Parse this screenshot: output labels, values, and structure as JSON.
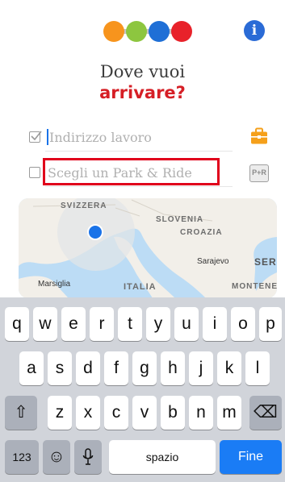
{
  "header": {
    "logo_colors": [
      "#f7941d",
      "#8dc63f",
      "#1f6fd6",
      "#e8222a"
    ],
    "info_icon": "info-icon",
    "info_symbol": "i"
  },
  "headline": {
    "line1": "Dove vuoi",
    "line2": "arrivare?",
    "accent_color": "#d61f26"
  },
  "fields": {
    "work": {
      "placeholder": "Indirizzo lavoro",
      "checked": true,
      "action_icon": "briefcase-icon",
      "action_color": "#f5a01b"
    },
    "park_ride": {
      "placeholder": "Scegli un Park & Ride",
      "checked": false,
      "action_icon": "park-and-ride-icon",
      "action_label": "P+R"
    }
  },
  "map": {
    "labels": [
      "SVIZZERA",
      "SLOVENIA",
      "CROAZIA",
      "Sarajevo",
      "SER",
      "Marsiglia",
      "ITALIA",
      "MONTENEGR"
    ]
  },
  "keyboard": {
    "row1": [
      "q",
      "w",
      "e",
      "r",
      "t",
      "y",
      "u",
      "i",
      "o",
      "p"
    ],
    "row2": [
      "a",
      "s",
      "d",
      "f",
      "g",
      "h",
      "j",
      "k",
      "l"
    ],
    "row3": [
      "z",
      "x",
      "c",
      "v",
      "b",
      "n",
      "m"
    ],
    "shift_symbol": "⇧",
    "delete_symbol": "⌫",
    "numbers_label": "123",
    "emoji_symbol": "☺",
    "mic_icon": "microphone-icon",
    "space_label": "spazio",
    "return_label": "Fine"
  }
}
